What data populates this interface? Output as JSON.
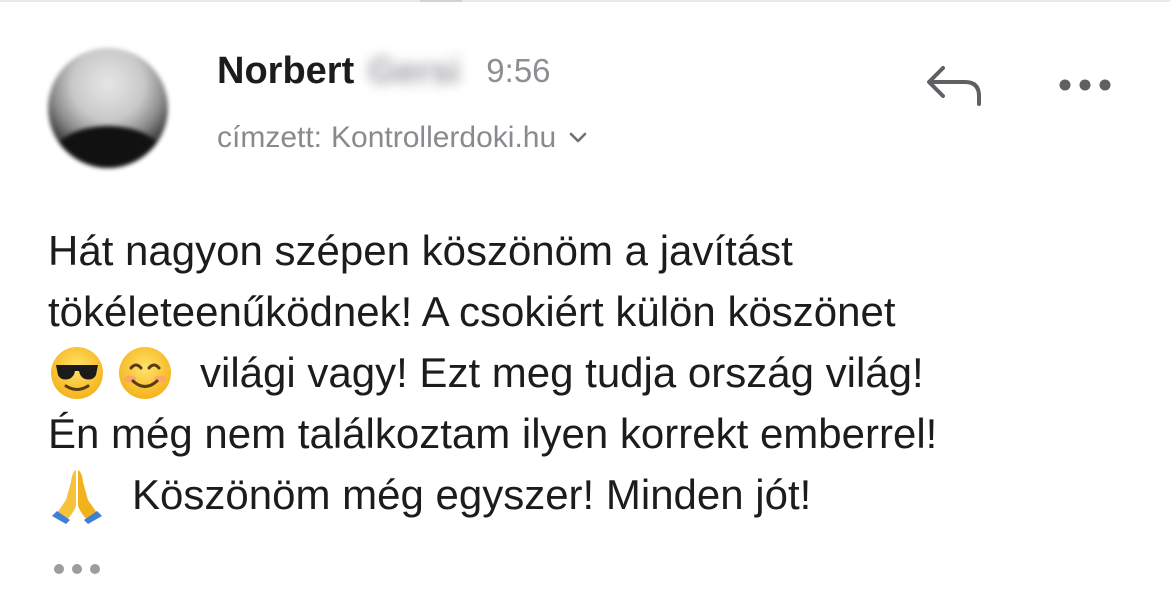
{
  "email": {
    "sender": {
      "first_name": "Norbert",
      "surname_redacted": "Gersi"
    },
    "time": "9:56",
    "recipient": {
      "label": "címzett:",
      "value": "Kontrollerdoki.hu"
    },
    "body_lines": [
      {
        "text": "Hát nagyon szépen köszönöm a javítást"
      },
      {
        "text": "tökéleteenűködnek! A csokiért külön köszönet"
      },
      {
        "emojis": [
          "sunglasses-face",
          "smiling-face"
        ],
        "text": "világi vagy! Ezt meg tudja ország világ!"
      },
      {
        "text": "Én még nem találkoztam ilyen korrekt emberrel!"
      },
      {
        "emojis": [
          "folded-hands"
        ],
        "text": "Köszönöm még egyszer! Minden jót!"
      }
    ]
  },
  "icons": {
    "reply": "reply-icon",
    "more": "more-icon",
    "chevron": "chevron-down-icon",
    "expand": "ellipsis-icon"
  },
  "colors": {
    "text_primary": "#1c1c1e",
    "text_secondary": "#8a8a8e",
    "icon": "#5f5f64",
    "divider": "#e9e9ec"
  }
}
